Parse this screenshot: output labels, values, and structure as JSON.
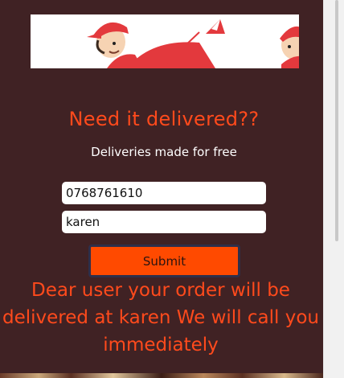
{
  "form": {
    "heading": "Need it delivered??",
    "subheading": "Deliveries made for free",
    "phone_value": "0768761610",
    "location_value": "karen",
    "submit_label": "Submit"
  },
  "confirmation": {
    "message": "Dear user your order will be delivered at karen We will call you immediately"
  },
  "colors": {
    "panel_background": "#402224",
    "accent": "#ff4a1c",
    "button": "#ff4a00"
  }
}
